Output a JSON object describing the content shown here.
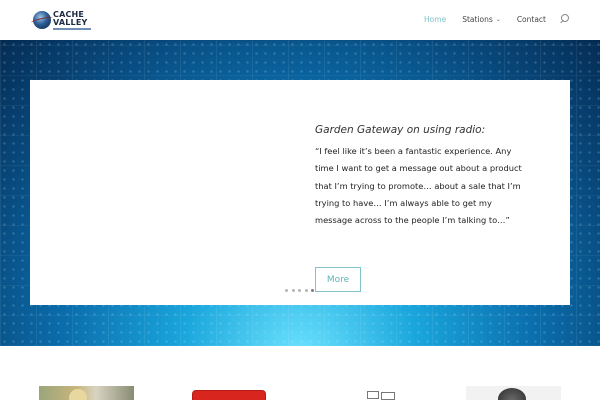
{
  "header": {
    "logo": {
      "line1": "CACHE",
      "line2": "VALLEY"
    },
    "nav": [
      {
        "label": "Home",
        "active": true
      },
      {
        "label": "Stations",
        "has_dropdown": true
      },
      {
        "label": "Contact"
      }
    ],
    "search_icon": "search-icon"
  },
  "slide": {
    "title": "Garden Gateway on using radio:",
    "quote": "“I feel like it’s been a fantastic experience. Any time I want to get a message out about a product that I’m trying to promote… about a sale that I’m trying to have… I’m always able to get my message across to the people I’m talking to…”",
    "button_label": "More"
  },
  "slider": {
    "dot_count": 5,
    "active_index": 4
  },
  "colors": {
    "accent": "#7ec3c8",
    "hero_center": "#1aa6dc",
    "hero_edge": "#052c54",
    "thumb_red": "#d8261e"
  },
  "thumbnails": [
    {
      "icon": "person-photo"
    },
    {
      "icon": "red-sign-image"
    },
    {
      "icon": "sketch-image"
    },
    {
      "icon": "microphone-image"
    }
  ]
}
